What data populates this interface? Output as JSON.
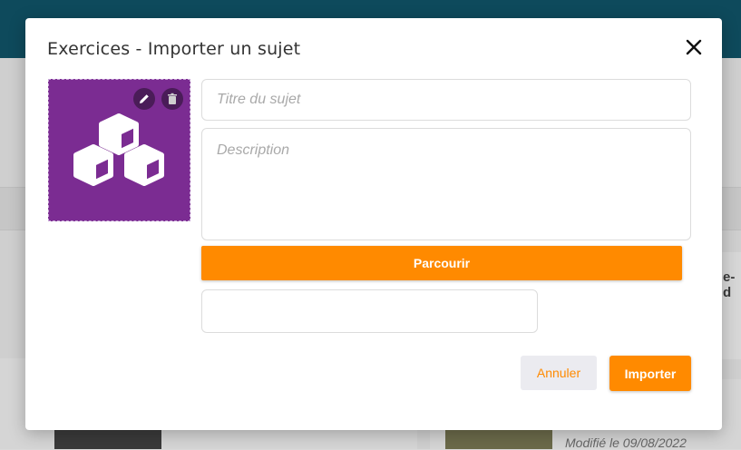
{
  "background": {
    "peek_text": "e-d",
    "card_modified": "Modifié le 09/08/2022"
  },
  "modal": {
    "title": "Exercices - Importer un sujet",
    "close_icon": "close-icon",
    "thumbnail": {
      "color": "#7b2c92",
      "icon": "cubes-icon",
      "edit_icon": "pencil-icon",
      "delete_icon": "trash-icon"
    },
    "title_field": {
      "placeholder": "Titre du sujet",
      "value": ""
    },
    "description_field": {
      "placeholder": "Description",
      "value": ""
    },
    "browse_label": "Parcourir",
    "file_field": {
      "value": ""
    },
    "cancel_label": "Annuler",
    "import_label": "Importer",
    "accent_color": "#ff8a00"
  }
}
